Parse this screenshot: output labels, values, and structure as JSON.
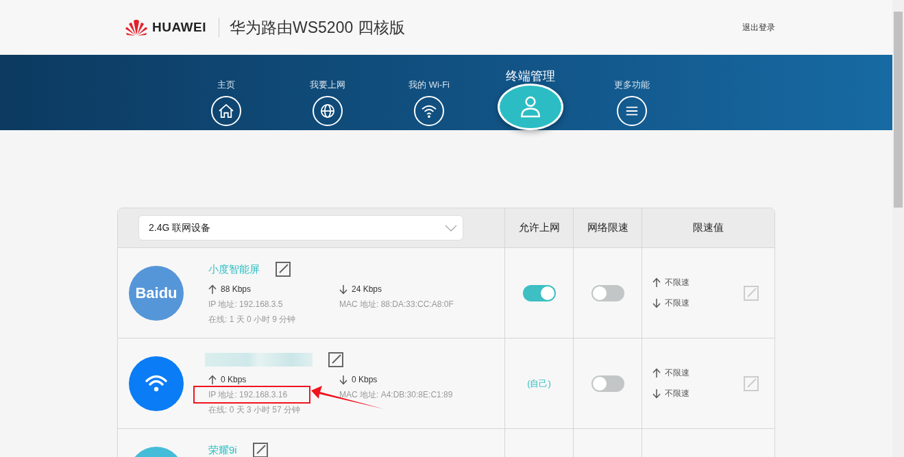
{
  "header": {
    "brand": "HUAWEI",
    "title": "华为路由WS5200 四核版",
    "logout": "退出登录"
  },
  "nav": [
    {
      "label": "主页",
      "selected": false
    },
    {
      "label": "我要上网",
      "selected": false
    },
    {
      "label": "我的 Wi-Fi",
      "selected": false
    },
    {
      "label": "终端管理",
      "selected": true
    },
    {
      "label": "更多功能",
      "selected": false
    }
  ],
  "table": {
    "filter": {
      "value": "2.4G 联网设备"
    },
    "columns": [
      "允许上网",
      "网络限速",
      "限速值"
    ],
    "rows": [
      {
        "avatar": {
          "kind": "text",
          "text": "Baidu",
          "color": "#5596d8"
        },
        "name": "小度智能屏",
        "name_redacted": false,
        "up": "88 Kbps",
        "down": "24 Kbps",
        "ip": "IP 地址: 192.168.3.5",
        "ip_highlighted": false,
        "mac": "MAC 地址: 88:DA:33:CC:A8:0F",
        "online": "在线: 1 天 0 小时 9 分钟",
        "access": {
          "kind": "toggle",
          "on": true
        },
        "limit_on": false,
        "limit_up": "不限速",
        "limit_down": "不限速"
      },
      {
        "avatar": {
          "kind": "wifi",
          "color": "#0a7cf5"
        },
        "name_redacted": true,
        "up": "0 Kbps",
        "down": "0 Kbps",
        "ip": "IP 地址: 192.168.3.16",
        "ip_highlighted": true,
        "mac": "MAC 地址: A4:DB:30:8E:C1:89",
        "online": "在线: 0 天 3 小时 57 分钟",
        "access": {
          "kind": "text",
          "text": "(自己)"
        },
        "limit_on": false,
        "limit_up": "不限速",
        "limit_down": "不限速"
      },
      {
        "avatar": {
          "kind": "blank",
          "color": "#45bcd8"
        },
        "name": "荣耀9i",
        "name_redacted": false
      }
    ]
  }
}
